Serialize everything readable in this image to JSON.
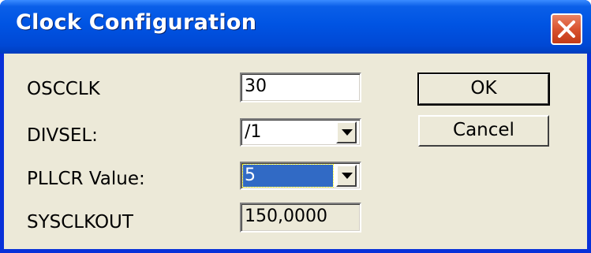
{
  "window": {
    "title": "Clock Configuration",
    "close_icon": "close-icon"
  },
  "fields": {
    "osc": {
      "label": "OSCCLK",
      "value": "30"
    },
    "divsel": {
      "label": "DIVSEL:",
      "value": "/1"
    },
    "pllcr": {
      "label": "PLLCR Value:",
      "value": "5"
    },
    "sysclk": {
      "label": "SYSCLKOUT",
      "value": "150,0000"
    }
  },
  "buttons": {
    "ok": "OK",
    "cancel": "Cancel"
  },
  "colors": {
    "titlebar": "#0054e3",
    "client": "#ece9d8",
    "selection": "#316ac5",
    "close": "#d9532f"
  }
}
